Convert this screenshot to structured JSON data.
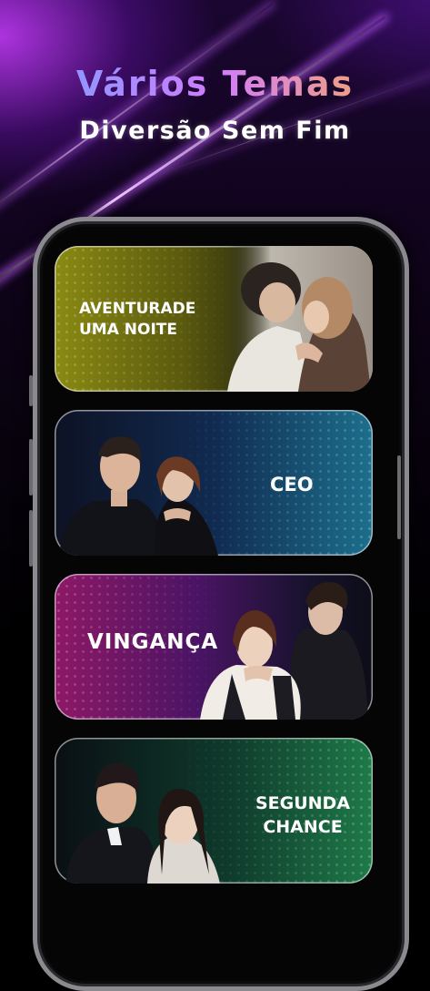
{
  "header": {
    "title": "Vários Temas",
    "subtitle": "Diversão Sem Fim"
  },
  "categories": [
    {
      "label": "AVENTURADE\nUMA NOITE",
      "line1": "AVENTURADE",
      "line2": "UMA NOITE",
      "accent": "#8a8a12"
    },
    {
      "label": "CEO",
      "accent": "#1c6f8c"
    },
    {
      "label": "VINGANÇA",
      "accent": "#8e1866"
    },
    {
      "label": "SEGUNDA\nCHANCE",
      "line1": "SEGUNDA",
      "line2": "CHANCE",
      "accent": "#1e7a48"
    }
  ],
  "colors": {
    "title_gradient": [
      "#6fa3ff",
      "#d07cff",
      "#ffb23d"
    ],
    "background": "#000000",
    "glow": "#c83cff"
  }
}
